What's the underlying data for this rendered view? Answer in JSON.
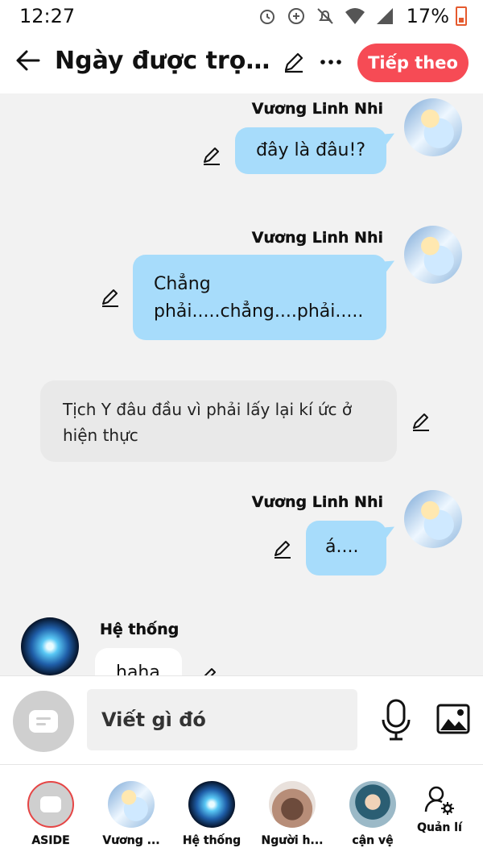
{
  "status_bar": {
    "time": "12:27",
    "battery": "17%"
  },
  "header": {
    "title": "Ngày được trọn...",
    "next_label": "Tiếp theo"
  },
  "messages": [
    {
      "type": "user",
      "name": "Vương Linh Nhi",
      "text": "đây là đâu!?"
    },
    {
      "type": "user",
      "name": "Vương Linh Nhi",
      "text_line1": "Chẳng",
      "text_line2": "phải.....chẳng....phải....."
    },
    {
      "type": "narration",
      "text_line1": "Tịch Y đâu đầu vì phải lấy lại kí ức ở",
      "text_line2": "hiện thực"
    },
    {
      "type": "user",
      "name": "Vương Linh Nhi",
      "text": "á...."
    },
    {
      "type": "character",
      "name": "Hệ thống",
      "text": "haha"
    }
  ],
  "composer": {
    "placeholder": "Viết gì đó"
  },
  "characters": [
    {
      "label": "ASIDE"
    },
    {
      "label": "Vương ..."
    },
    {
      "label": "Hệ thống"
    },
    {
      "label": "Người h..."
    },
    {
      "label": "cận vệ"
    },
    {
      "label": "Quản lí"
    }
  ],
  "icons": [
    "alarm-icon",
    "add-circle-icon",
    "bell-off-icon",
    "wifi-icon",
    "signal-icon",
    "battery-icon",
    "back-arrow-icon",
    "pencil-icon",
    "more-icon",
    "microphone-icon",
    "image-icon",
    "manage-users-icon"
  ],
  "colors": {
    "accent": "#f64b55",
    "user_bubble": "#a7dcfb",
    "narration": "#e9e9e9"
  }
}
